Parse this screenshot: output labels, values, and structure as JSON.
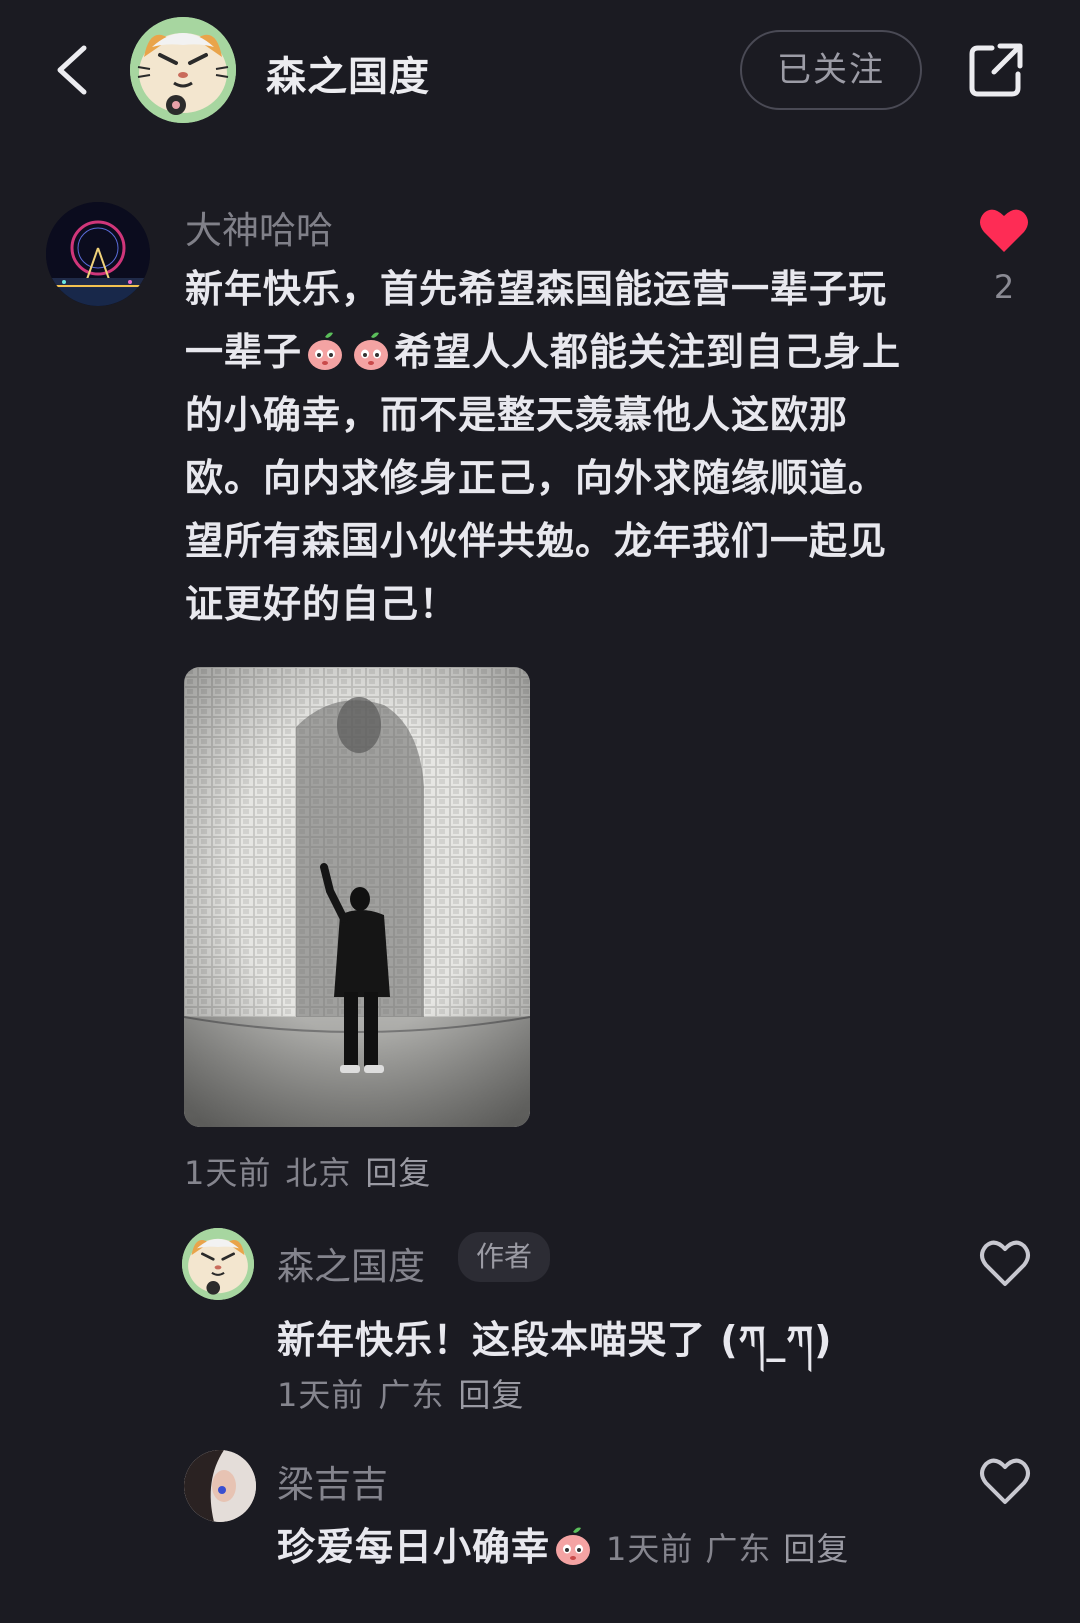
{
  "header": {
    "title": "森之国度",
    "follow_label": "已关注"
  },
  "main_comment": {
    "username": "大神哈哈",
    "text_parts": [
      "新年快乐，首先希望森国能运营一辈子玩一辈子",
      "希望人人都能关注到自己身上的小确幸，而不是整天羡慕他人这欧那欧。向内求修身正己，向外求随缘顺道。望所有森国小伙伴共勉。龙年我们一起见证更好的自己！"
    ],
    "like_count": "2",
    "time": "1天前",
    "location": "北京",
    "reply_label": "回复"
  },
  "replies": [
    {
      "username": "森之国度",
      "badge": "作者",
      "text": "新年快乐！这段本喵哭了 (ཀ_ཀ)",
      "time": "1天前",
      "location": "广东",
      "reply_label": "回复"
    },
    {
      "username": "梁吉吉",
      "text": "珍爱每日小确幸",
      "time": "1天前",
      "location": "广东",
      "reply_label": "回复"
    }
  ],
  "colors": {
    "background": "#1b1b22",
    "like_active": "#fe2c55"
  },
  "icons": [
    "back-arrow-icon",
    "share-icon",
    "heart-filled-icon",
    "heart-outline-icon",
    "peach-emoji-icon"
  ]
}
